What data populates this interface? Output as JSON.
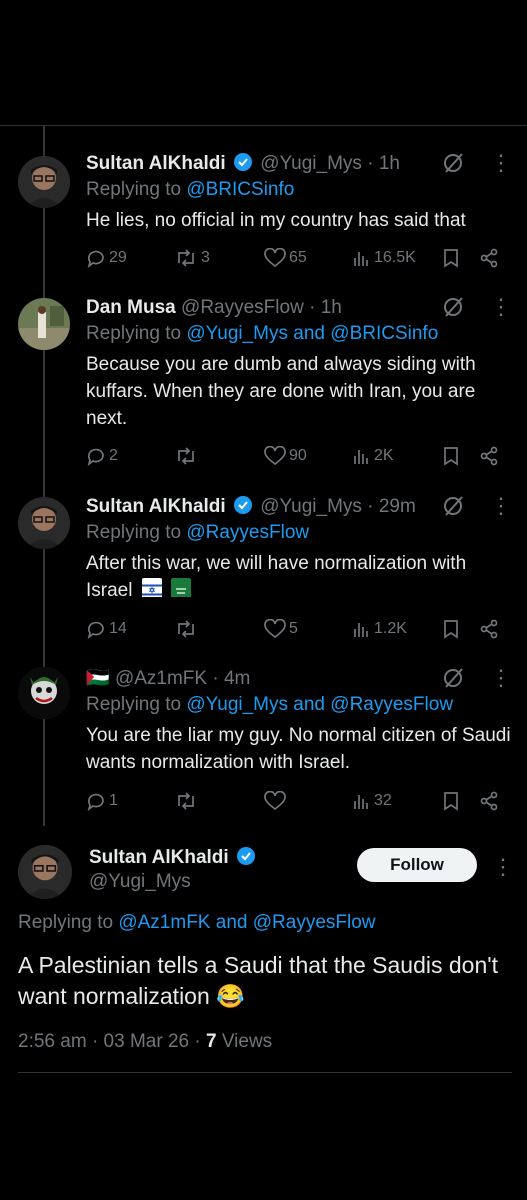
{
  "replies": [
    {
      "name": "Sultan AlKhaldi",
      "verified": true,
      "handle": "@Yugi_Mys",
      "time": "1h",
      "replying_to": [
        "@BRICSinfo"
      ],
      "text": "He lies, no official in my country has said that",
      "flags": [],
      "stats": {
        "replies": "29",
        "reposts": "3",
        "likes": "65",
        "views": "16.5K"
      }
    },
    {
      "name": "Dan Musa",
      "verified": false,
      "handle": "@RayyesFlow",
      "time": "1h",
      "replying_to": [
        "@Yugi_Mys",
        "@BRICSinfo"
      ],
      "text": "Because you are dumb and always siding with kuffars. When they are done with Iran, you are next.",
      "flags": [],
      "stats": {
        "replies": "2",
        "reposts": "",
        "likes": "90",
        "views": "2K"
      }
    },
    {
      "name": "Sultan AlKhaldi",
      "verified": true,
      "handle": "@Yugi_Mys",
      "time": "29m",
      "replying_to": [
        "@RayyesFlow"
      ],
      "text": "After this war, we will have normalization with Israel",
      "flags": [
        "israel-flag",
        "saudi-flag"
      ],
      "stats": {
        "replies": "14",
        "reposts": "",
        "likes": "5",
        "views": "1.2K"
      }
    },
    {
      "name": "🇵🇸",
      "verified": false,
      "handle": "@Az1mFK",
      "time": "4m",
      "replying_to": [
        "@Yugi_Mys",
        "@RayyesFlow"
      ],
      "text": "You are the liar my guy. No normal citizen of Saudi wants normalization with Israel.",
      "flags": [],
      "stats": {
        "replies": "1",
        "reposts": "",
        "likes": "",
        "views": "32"
      }
    }
  ],
  "main_post": {
    "name": "Sultan AlKhaldi",
    "handle": "@Yugi_Mys",
    "follow_label": "Follow",
    "replying_prefix": "Replying to",
    "replying_to": [
      "@Az1mFK",
      "@RayyesFlow"
    ],
    "text": "A Palestinian tells a Saudi that the Saudis don't want normalization 😂",
    "time": "2:56 am",
    "date": "03 Mar 26",
    "views_count": "7",
    "views_label": "Views"
  },
  "labels": {
    "replying_prefix": "Replying to",
    "and": "and",
    "dot": "·"
  },
  "colors": {
    "background": "#000000",
    "accent": "#1d9bf0",
    "muted": "#71767b",
    "text": "#e7e9ea",
    "verified": "#1d9bf0"
  }
}
